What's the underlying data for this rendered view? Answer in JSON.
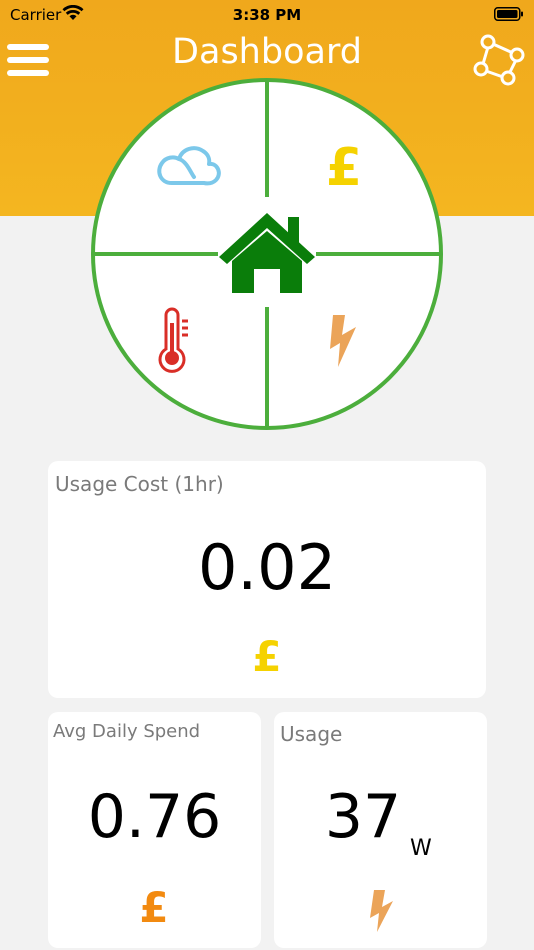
{
  "status_bar": {
    "carrier": "Carrier",
    "time": "3:38 PM"
  },
  "header": {
    "title": "Dashboard"
  },
  "icons": {
    "menu": "hamburger-menu-icon",
    "network": "network-nodes-icon",
    "weather": "cloud-icon",
    "cost": "pound-icon",
    "home": "house-icon",
    "temperature": "thermometer-icon",
    "power": "lightning-icon"
  },
  "colors": {
    "header": "#f4b620",
    "dial_ring": "#4cae3c",
    "house": "#0a7d0a",
    "cloud": "#7cc8ea",
    "pound_yellow": "#f5d200",
    "pound_orange": "#f28a10",
    "thermometer": "#d92e27",
    "lightning": "#eba459"
  },
  "cards": {
    "usage_cost": {
      "label": "Usage Cost (1hr)",
      "value": "0.02"
    },
    "avg_daily_spend": {
      "label": "Avg Daily Spend",
      "value": "0.76"
    },
    "usage": {
      "label": "Usage",
      "value": "37",
      "unit": "W"
    }
  }
}
